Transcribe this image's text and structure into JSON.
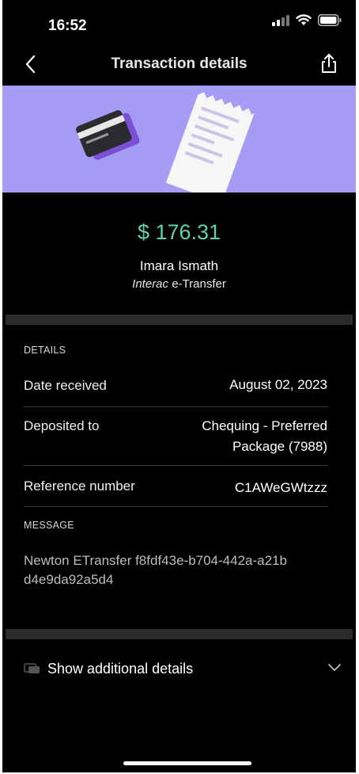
{
  "status_bar": {
    "time": "16:52"
  },
  "header": {
    "title": "Transaction details",
    "back_icon": "chevron-left-icon",
    "share_icon": "share-icon"
  },
  "colors": {
    "banner": "#a59cf5",
    "amount": "#5fd3a5",
    "background": "#000000"
  },
  "transaction": {
    "amount": "$ 176.31",
    "sender": "Imara Ismath",
    "method_brand": "Interac",
    "method_suffix": " e-Transfer"
  },
  "details": {
    "section_label": "DETAILS",
    "date_label": "Date received",
    "date_value": "August 02, 2023",
    "deposited_label": "Deposited to",
    "deposited_value_line1": "Chequing - Preferred",
    "deposited_value_line2": "Package (7988)",
    "reference_label": "Reference number",
    "reference_value": "C1AWeGWtzzz"
  },
  "message": {
    "section_label": "MESSAGE",
    "text_line1": "Newton ETransfer f8fdf43e-b704-442a-a21b",
    "text_line2": "d4e9da92a5d4"
  },
  "additional": {
    "label": "Show additional details",
    "icon": "details-icon",
    "chevron": "chevron-down-icon"
  }
}
